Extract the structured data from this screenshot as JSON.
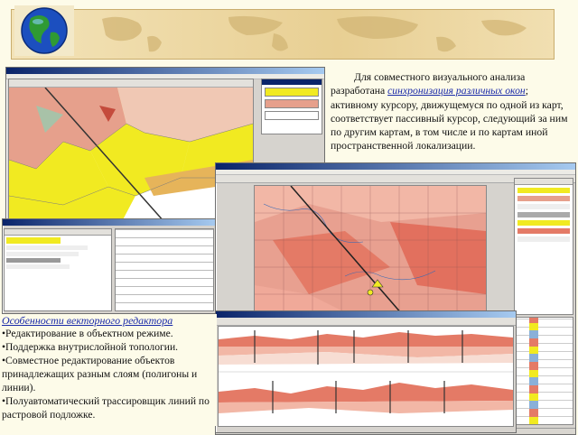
{
  "description": {
    "before": "Для совместного визуального анализа разработана ",
    "link": "синхронизация различных окон",
    "after": "; активному курсору, движущемуся по одной из карт, соответствует пассивный курсор, следующий за ним по другим картам, в том числе и по картам иной пространственной локализации."
  },
  "vector_editor": {
    "heading": "Особенности векторного редактора",
    "items": [
      "•Редактирование в объектном режиме.",
      "•Поддержка внутрислойной топологии.",
      "•Совместное редактирование объектов принадлежащих разным слоям (полигоны и линии).",
      "•Полуавтоматический трассировщик линий по растровой подложке."
    ]
  },
  "icons": {
    "banner": "world-map-banner",
    "globe": "globe-icon",
    "window_left": "geology-map-app-window",
    "window_right": "raster-map-app-window",
    "profile": "cross-section-profile-window"
  },
  "colors": {
    "background": "#fdfbe9",
    "link": "#1a2aa8",
    "map_yellow": "#f1ea21",
    "map_pink": "#e6a08c",
    "map_salmon": "#e47a66"
  }
}
